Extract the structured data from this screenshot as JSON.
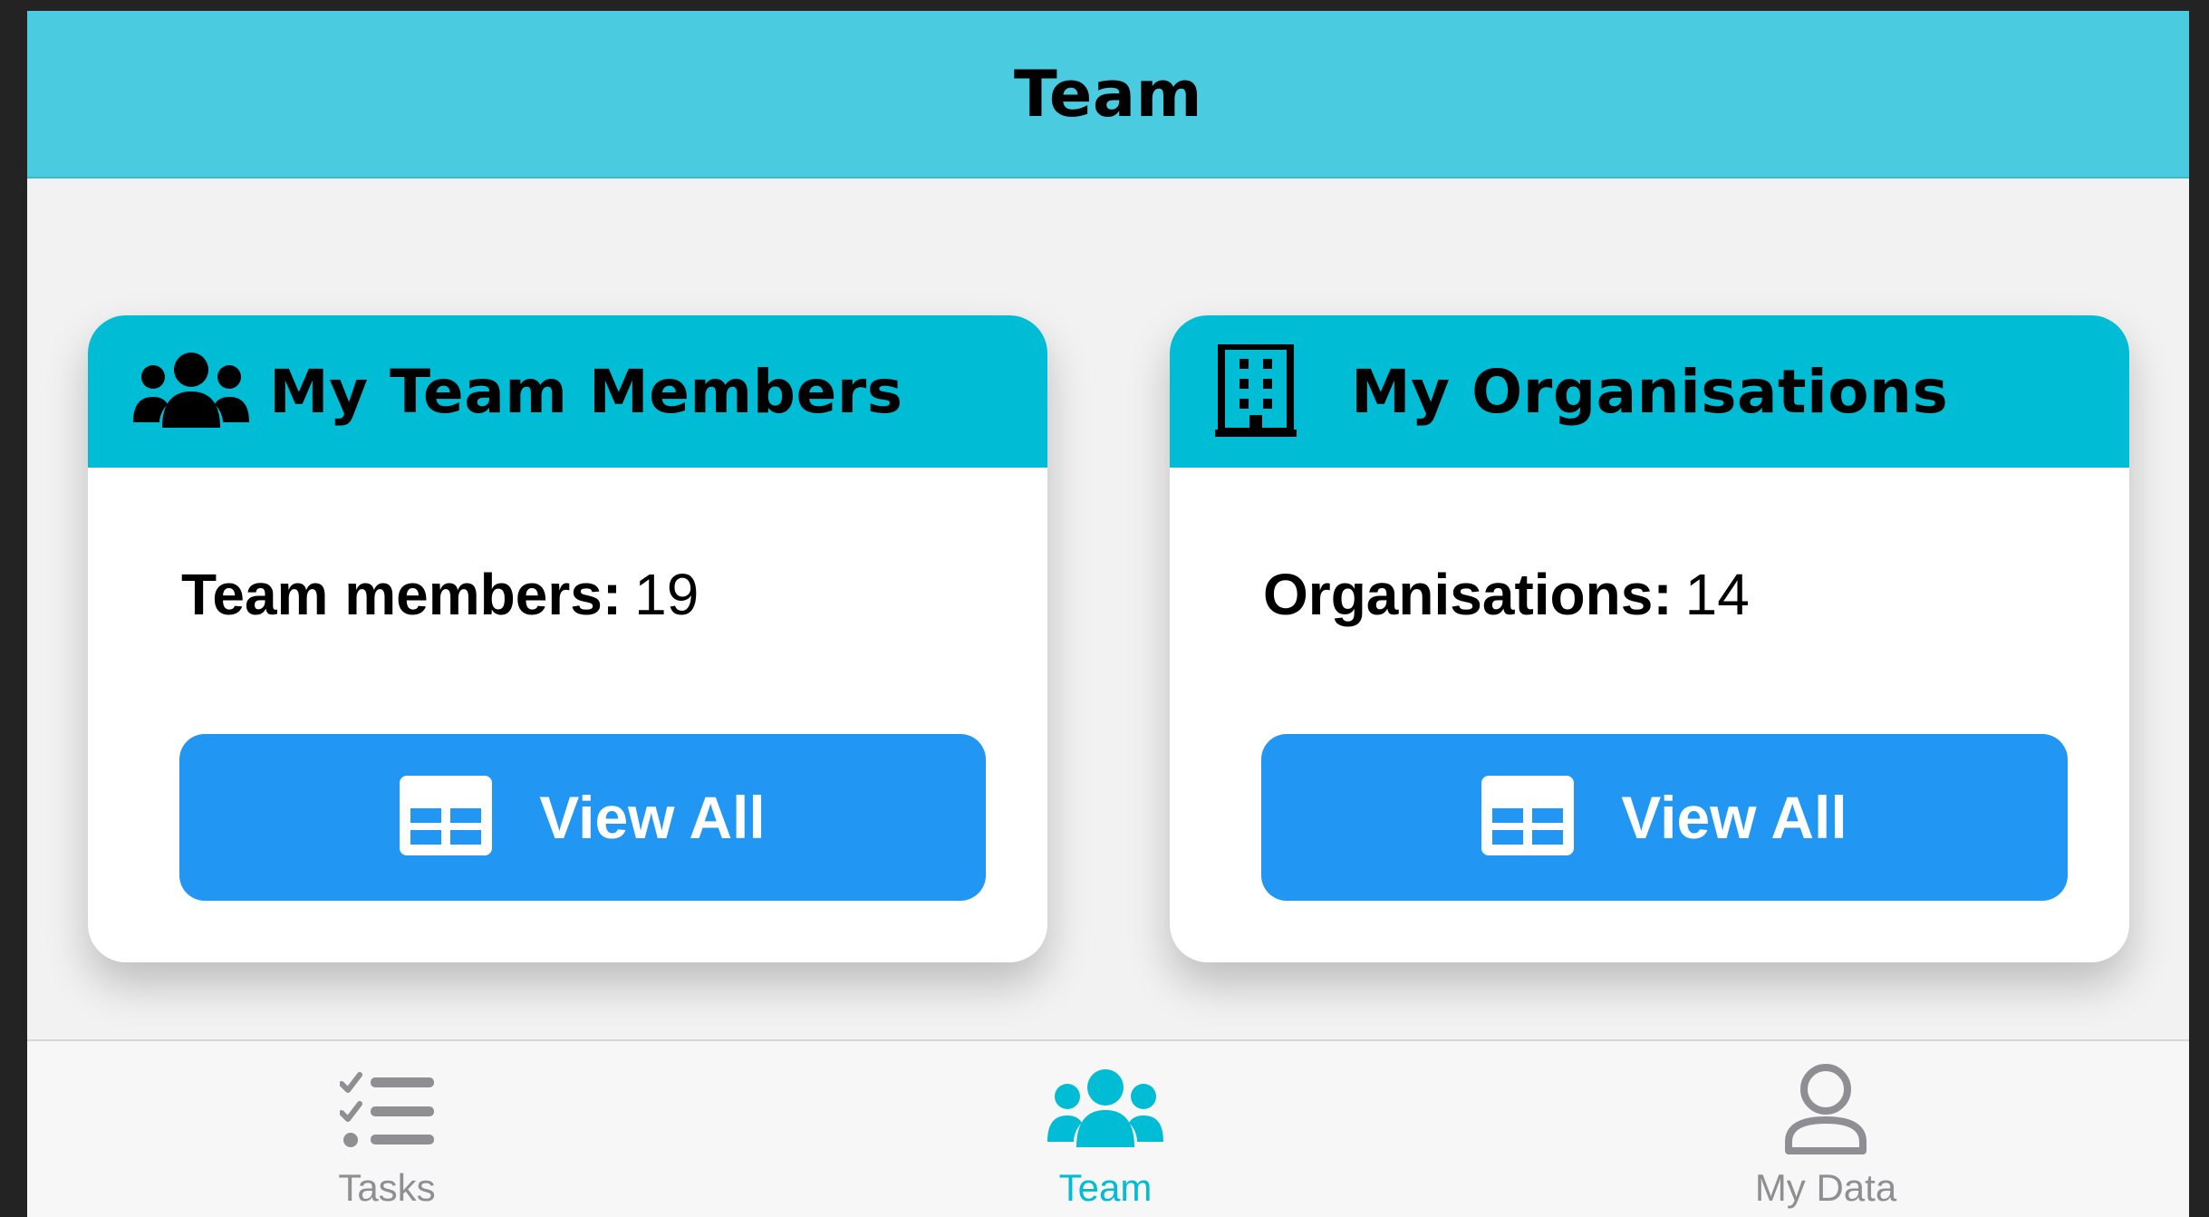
{
  "header": {
    "title": "Team"
  },
  "cards": [
    {
      "title": "My Team Members",
      "icon": "users-icon",
      "stat_label": "Team members:",
      "stat_value": "19",
      "button_label": "View All",
      "button_icon": "table-icon"
    },
    {
      "title": "My Organisations",
      "icon": "building-icon",
      "stat_label": "Organisations:",
      "stat_value": "14",
      "button_label": "View All",
      "button_icon": "table-icon"
    }
  ],
  "tabs": [
    {
      "label": "Tasks",
      "icon": "tasks-list-icon",
      "active": false
    },
    {
      "label": "Team",
      "icon": "users-icon",
      "active": true
    },
    {
      "label": "My Data",
      "icon": "user-icon",
      "active": false
    }
  ],
  "colors": {
    "top_bar": "#4acbdf",
    "card_header": "#00bcd4",
    "button": "#2196f3",
    "active_tab": "#00bcd4",
    "inactive_tab": "#8e8e93"
  }
}
